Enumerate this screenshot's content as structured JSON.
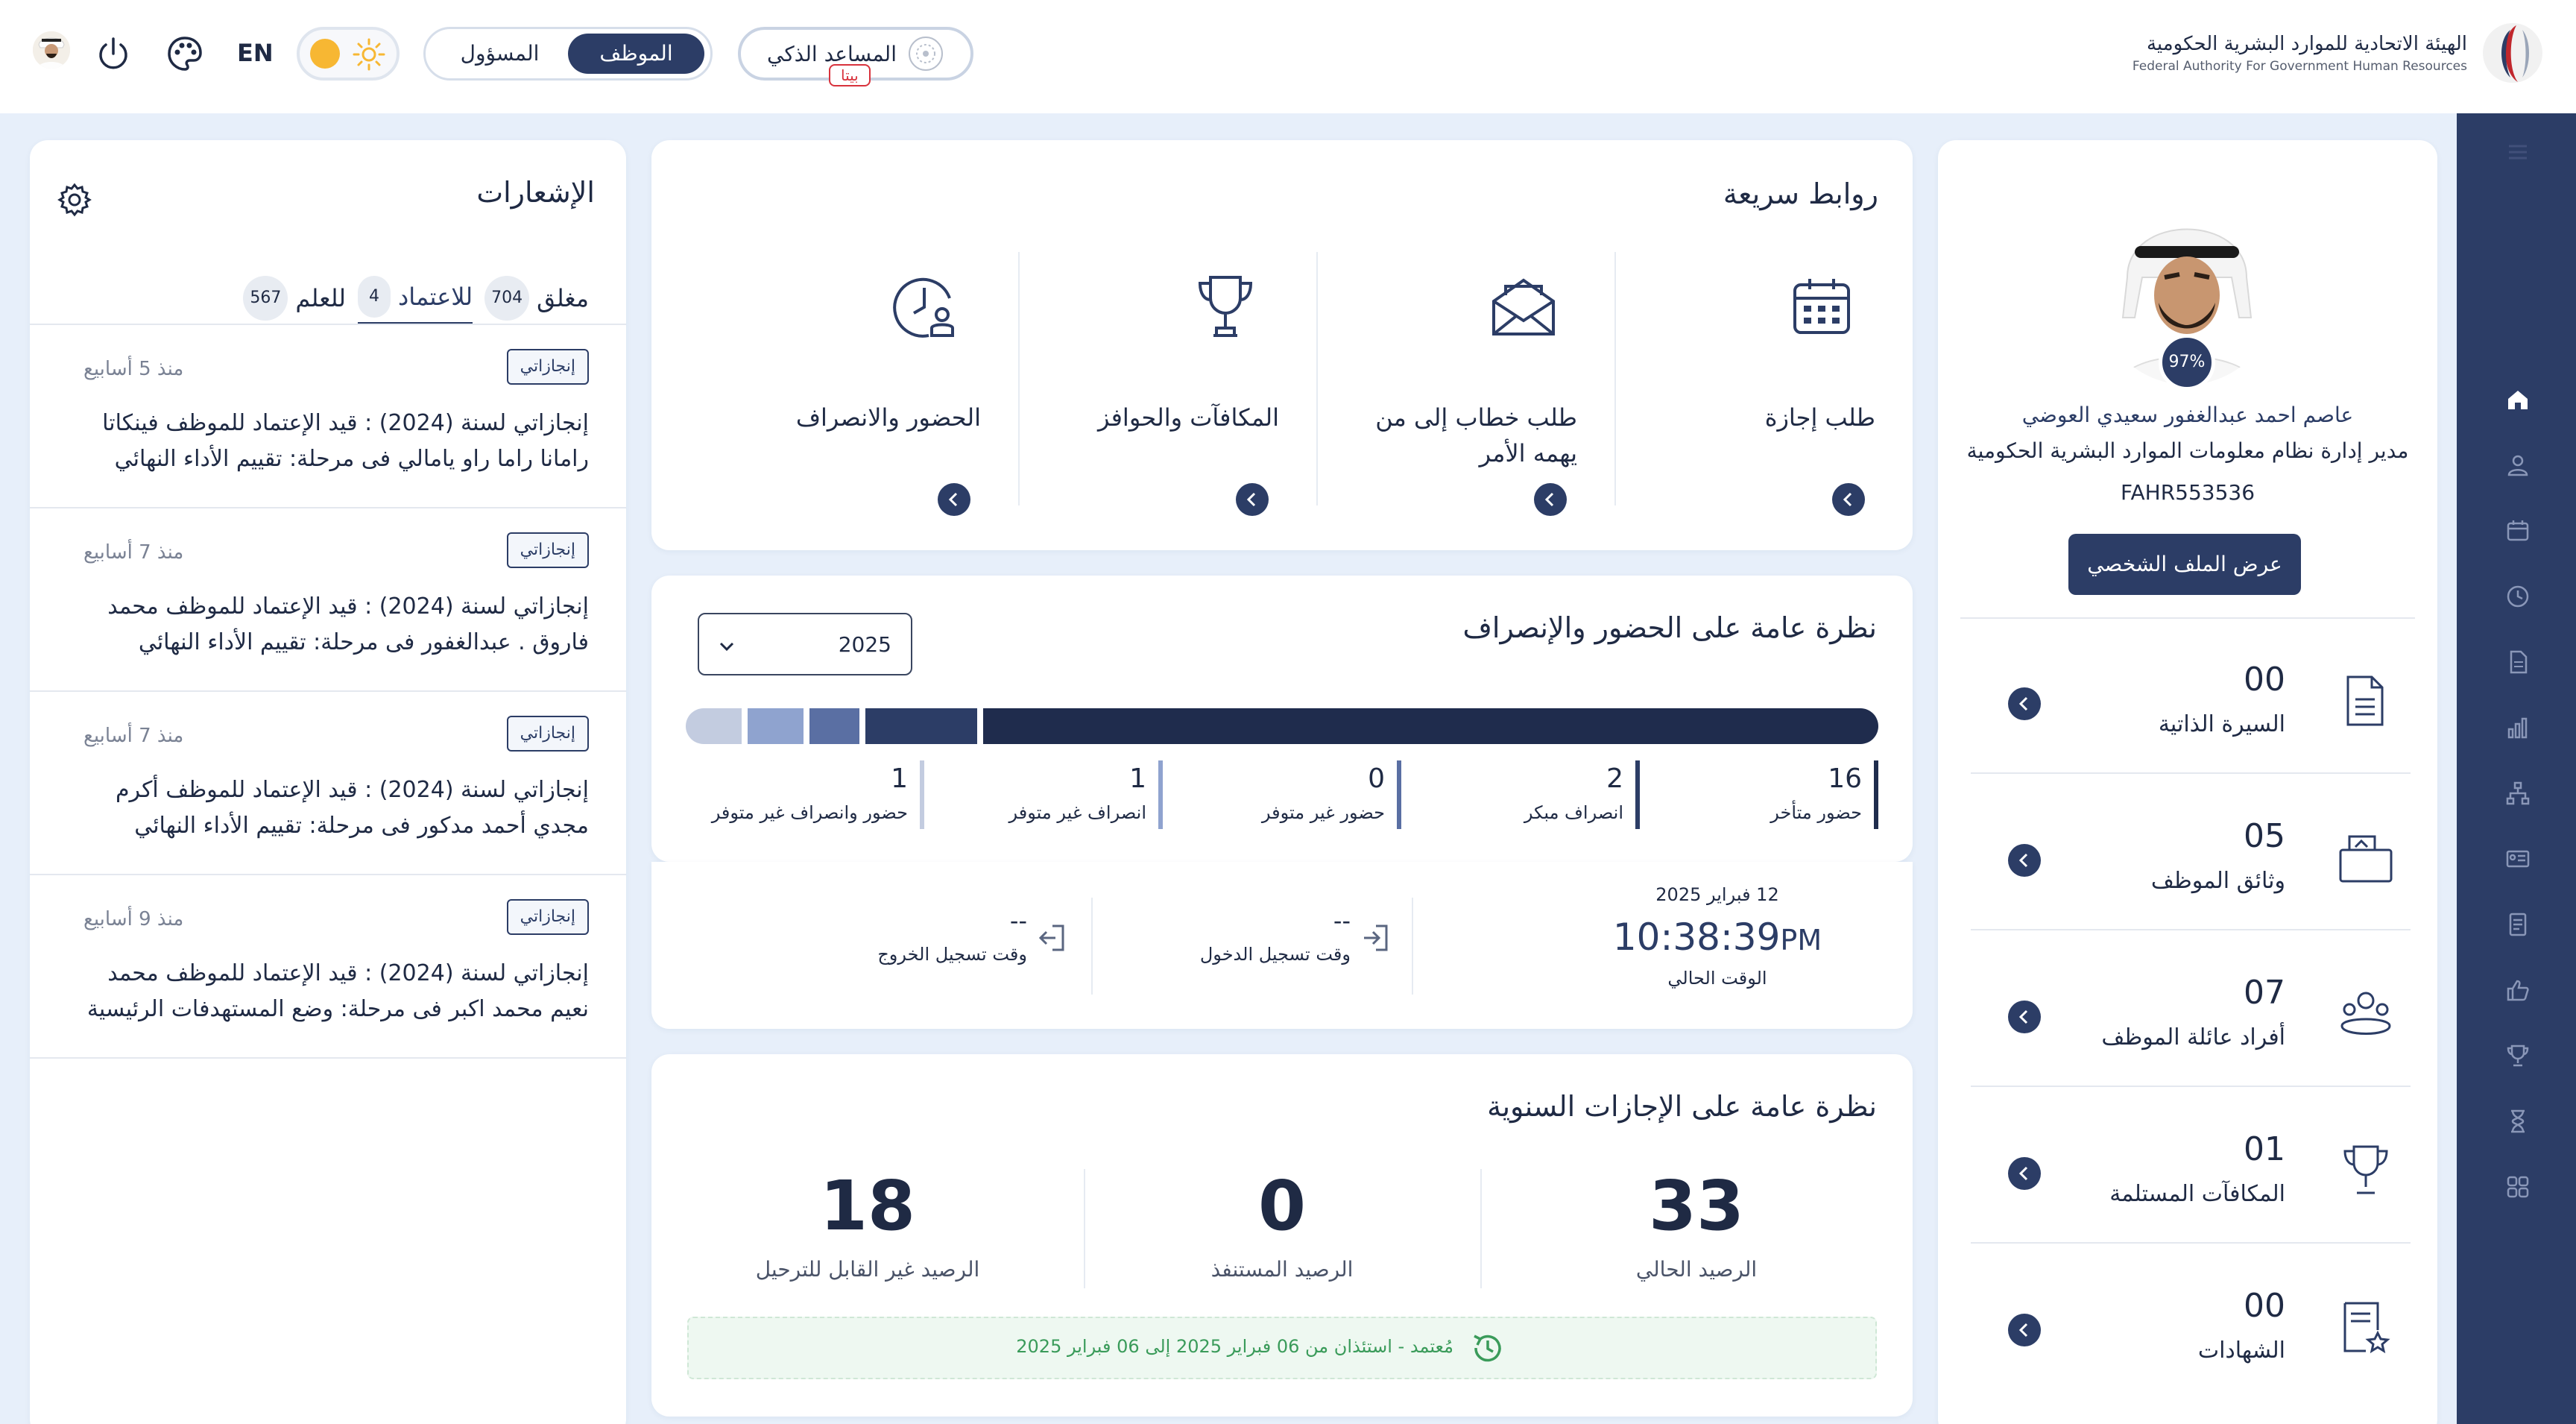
{
  "header": {
    "brand_ar": "الهيئة الاتحادية للموارد البشرية الحكومية",
    "brand_en": "Federal Authority For Government Human Resources",
    "ai_label": "المساعد الذكي",
    "beta": "بيتا",
    "roles": [
      "الموظف",
      "المسؤول"
    ],
    "active_role": "الموظف",
    "lang": "EN"
  },
  "profile": {
    "completion": "97%",
    "name": "عاصم احمد عبدالغفور سعيدي العوضي",
    "title": "مدير إدارة نظام معلومات الموارد البشرية الحكومية",
    "code": "FAHR553536",
    "view_button": "عرض الملف الشخصي",
    "stats": [
      {
        "value": "00",
        "label": "السيرة الذاتية",
        "icon": "resume-icon"
      },
      {
        "value": "05",
        "label": "وثائق الموظف",
        "icon": "documents-icon"
      },
      {
        "value": "07",
        "label": "أفراد عائلة الموظف",
        "icon": "family-icon"
      },
      {
        "value": "01",
        "label": "المكافآت المستلمة",
        "icon": "trophy-icon"
      },
      {
        "value": "00",
        "label": "الشهادات",
        "icon": "certificate-icon"
      }
    ]
  },
  "quick_links": {
    "title": "روابط سريعة",
    "items": [
      {
        "label": "طلب إجازة",
        "icon": "calendar-icon"
      },
      {
        "label": "طلب خطاب إلى من يهمه الأمر",
        "icon": "letter-icon"
      },
      {
        "label": "المكافآت والحوافز",
        "icon": "trophy-icon"
      },
      {
        "label": "الحضور والانصراف",
        "icon": "attendance-clock-icon"
      }
    ]
  },
  "attendance": {
    "title": "نظرة عامة على الحضور والإنصراف",
    "year": "2025",
    "legend": [
      {
        "value": "16",
        "label": "حضور متأخر",
        "color": "#1f2c4d"
      },
      {
        "value": "2",
        "label": "انصراف مبكر",
        "color": "#2c3d66"
      },
      {
        "value": "0",
        "label": "حضور غير متوفر",
        "color": "#5a6fa3"
      },
      {
        "value": "1",
        "label": "انصراف غير متوفر",
        "color": "#8fa3cf"
      },
      {
        "value": "1",
        "label": "حضور وانصراف غير متوفر",
        "color": "#c3cce0"
      }
    ]
  },
  "clock": {
    "date": "12 فبراير 2025",
    "time": "10:38:39",
    "ampm": "PM",
    "time_label": "الوقت الحالي",
    "checkin_value": "--",
    "checkin_label": "وقت تسجيل الدخول",
    "checkout_value": "--",
    "checkout_label": "وقت تسجيل الخروج"
  },
  "leave": {
    "title": "نظرة عامة على الإجازات السنوية",
    "current_value": "33",
    "current_label": "الرصيد الحالي",
    "used_value": "0",
    "used_label": "الرصيد المستنفذ",
    "nontransfer_value": "18",
    "nontransfer_label": "الرصيد غير القابل للترحيل",
    "note": "مُعتمد - استئذان من 06 فبراير 2025 إلى 06 فبراير 2025"
  },
  "notifications": {
    "title": "الإشعارات",
    "tabs": [
      {
        "label": "مغلق",
        "count": "704"
      },
      {
        "label": "للاعتماد",
        "count": "4"
      },
      {
        "label": "للعلم",
        "count": "567"
      }
    ],
    "items": [
      {
        "badge": "إنجازاتي",
        "time": "منذ 5 أسابيع",
        "text": "إنجازاتي لسنة (2024) : قيد الإعتماد للموظف فينكاتا رامانا راما راو يامالي فى مرحلة: تقييم الأداء النهائي"
      },
      {
        "badge": "إنجازاتي",
        "time": "منذ 7 أسابيع",
        "text": "إنجازاتي لسنة (2024) : قيد الإعتماد للموظف محمد فاروق . عبدالغفور فى مرحلة: تقييم الأداء النهائي"
      },
      {
        "badge": "إنجازاتي",
        "time": "منذ 7 أسابيع",
        "text": "إنجازاتي لسنة (2024) : قيد الإعتماد للموظف أكرم مجدي أحمد مدكور فى مرحلة: تقييم الأداء النهائي"
      },
      {
        "badge": "إنجازاتي",
        "time": "منذ 9 أسابيع",
        "text": "إنجازاتي لسنة (2024) : قيد الإعتماد للموظف محمد نعيم محمد اكبر فى مرحلة: وضع المستهدفات الرئيسية"
      }
    ]
  },
  "sidenav_icons": [
    "menu-icon",
    "home-icon",
    "user-icon",
    "calendar-icon",
    "clock-icon",
    "document-icon",
    "chart-icon",
    "org-chart-icon",
    "id-card-icon",
    "file-icon",
    "thumbs-up-icon",
    "trophy-icon",
    "hourglass-icon",
    "apps-grid-icon"
  ]
}
